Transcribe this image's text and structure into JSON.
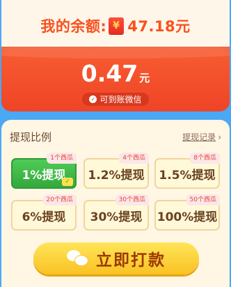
{
  "balance": {
    "label": "我的余额:",
    "icon": "rmb-envelope-icon",
    "value": "47.18元"
  },
  "withdraw": {
    "amount": "0.47",
    "unit": "元",
    "note": "可到账微信"
  },
  "options": {
    "title": "提现比例",
    "record_link": "提现记录",
    "items": [
      {
        "label": "1%提现",
        "tag": "1个西瓜",
        "selected": true
      },
      {
        "label": "1.2%提现",
        "tag": "4个西瓜",
        "selected": false
      },
      {
        "label": "1.5%提现",
        "tag": "8个西瓜",
        "selected": false
      },
      {
        "label": "6%提现",
        "tag": "20个西瓜",
        "selected": false
      },
      {
        "label": "30%提现",
        "tag": "30个西瓜",
        "selected": false
      },
      {
        "label": "100%提现",
        "tag": "50个西瓜",
        "selected": false
      }
    ]
  },
  "action": {
    "button_label": "立即打款",
    "icon": "wechat-icon"
  },
  "colors": {
    "accent_red": "#f2492a",
    "selected_green": "#34a83c",
    "button_yellow": "#f9c222"
  }
}
